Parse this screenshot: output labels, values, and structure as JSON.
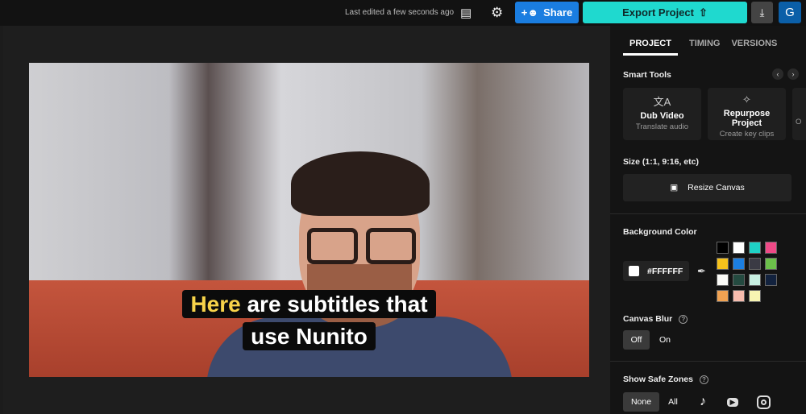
{
  "topbar": {
    "last_edited": "Last edited a few seconds ago",
    "share_label": "Share",
    "export_label": "Export Project",
    "avatar_initial": "G"
  },
  "video": {
    "subtitle_highlight": "Here",
    "subtitle_line1_rest": " are subtitles that",
    "subtitle_line2": "use Nunito",
    "highlight_color": "#f7d34a"
  },
  "panel": {
    "tabs": [
      "PROJECT",
      "TIMING",
      "VERSIONS"
    ],
    "smart_tools_title": "Smart Tools",
    "tools": [
      {
        "title": "Dub Video",
        "subtitle": "Translate audio"
      },
      {
        "title": "Repurpose Project",
        "subtitle": "Create key clips"
      },
      {
        "title": "",
        "subtitle": "O"
      }
    ],
    "size_title": "Size (1:1, 9:16, etc)",
    "resize_label": "Resize Canvas",
    "bg_title": "Background Color",
    "bg_value": "#FFFFFF",
    "swatches": [
      "#000000",
      "#ffffff",
      "#1fd2c6",
      "#ef4a87",
      "#f5c21b",
      "#1c7fe0",
      "#3a3a44",
      "#6cc04a",
      "#fbfbf7",
      "#244a40",
      "#c8f0e2",
      "#12223e",
      "#f0a252",
      "#f6bcae",
      "#f7f4b2"
    ],
    "blur_title": "Canvas Blur",
    "blur_off": "Off",
    "blur_on": "On",
    "safe_title": "Show Safe Zones",
    "safe_none": "None",
    "safe_all": "All"
  }
}
